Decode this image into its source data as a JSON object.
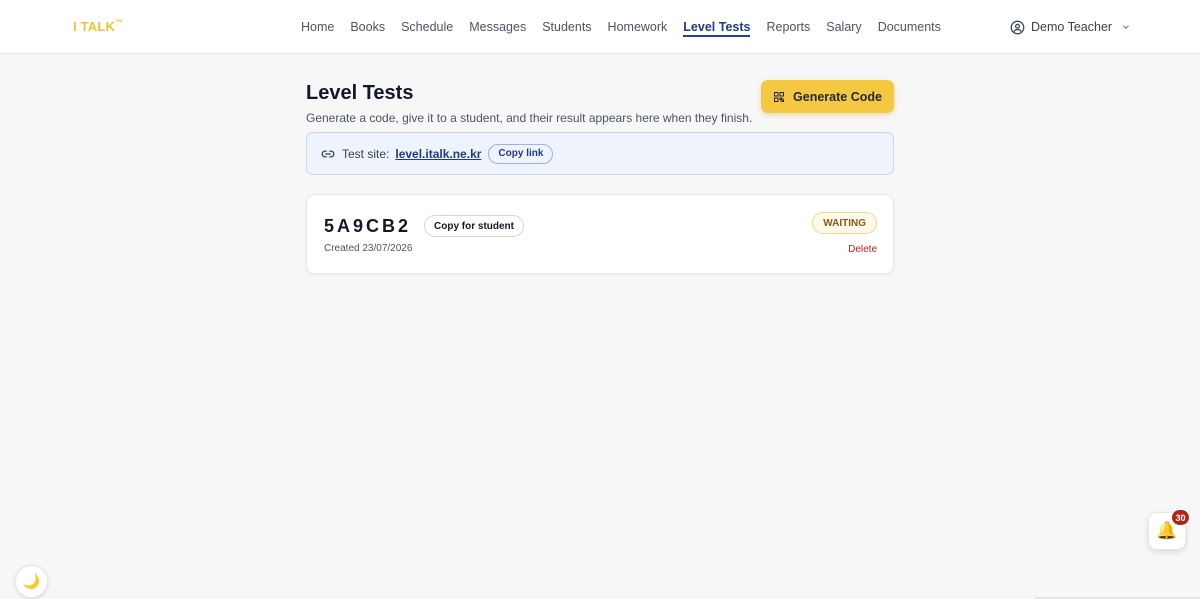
{
  "header": {
    "logo": "I TALK",
    "logo_tm": "™",
    "nav": [
      {
        "label": "Home",
        "active": false
      },
      {
        "label": "Books",
        "active": false
      },
      {
        "label": "Schedule",
        "active": false
      },
      {
        "label": "Messages",
        "active": false
      },
      {
        "label": "Students",
        "active": false
      },
      {
        "label": "Homework",
        "active": false
      },
      {
        "label": "Level Tests",
        "active": true
      },
      {
        "label": "Reports",
        "active": false
      },
      {
        "label": "Salary",
        "active": false
      },
      {
        "label": "Documents",
        "active": false
      }
    ],
    "user_name": "Demo Teacher",
    "user_icon": "user-circle-icon"
  },
  "page": {
    "title": "Level Tests",
    "subtitle": "Generate a code, give it to a student, and their result appears here when they finish.",
    "generate_button": "Generate Code",
    "generate_icon": "qr-code-icon"
  },
  "test_site": {
    "label": "Test site:",
    "url": "level.italk.ne.kr",
    "copy_button": "Copy link",
    "icon": "link-icon"
  },
  "codes": [
    {
      "code": "5A9CB2",
      "copy_button": "Copy for student",
      "created": "Created 23/07/2026",
      "status": "WAITING",
      "delete": "Delete"
    }
  ],
  "floating": {
    "theme_icon": "moon-icon",
    "notification_icon": "bell-icon",
    "notification_count": "30"
  },
  "colors": {
    "accent": "#f5c842",
    "nav_active": "#1e3a8a",
    "delete": "#b42318",
    "waiting": "#8a5a14"
  }
}
